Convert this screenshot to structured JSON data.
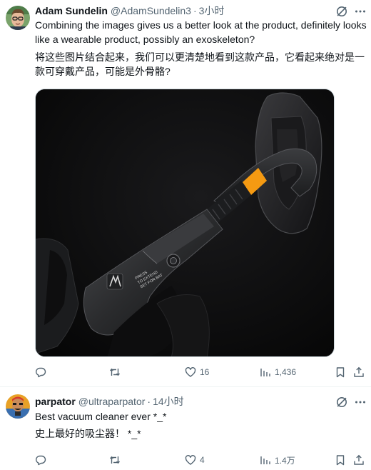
{
  "tweets": [
    {
      "author_name": "Adam Sundelin",
      "handle": "@AdamSundelin3",
      "separator": "·",
      "time": "3小时",
      "text_en": "Combining the images gives us a better look at the product, definitely looks like a wearable product, possibly an exoskeleton?",
      "text_zh": "将这些图片结合起来，我们可以更清楚地看到这款产品，它看起来绝对是一款可穿戴产品，可能是外骨骼?",
      "media_label_line1": "PRESS",
      "media_label_line2": "TO EXTEND",
      "media_label_line3": "SET FOR BAT",
      "reply_count": "",
      "retweet_count": "",
      "like_count": "16",
      "view_count": "1,436"
    },
    {
      "author_name": "parpator",
      "handle": "@ultraparpator",
      "separator": "·",
      "time": "14小时",
      "text_en": "Best vacuum cleaner ever *_*",
      "text_zh": "史上最好的吸尘器！ *_*",
      "reply_count": "",
      "retweet_count": "",
      "like_count": "4",
      "view_count": "1.4万"
    }
  ],
  "icons": {
    "grok": "grok-icon",
    "more": "more-icon",
    "reply": "reply-icon",
    "retweet": "retweet-icon",
    "like": "heart-icon",
    "views": "views-icon",
    "bookmark": "bookmark-icon",
    "share": "share-icon"
  },
  "colors": {
    "text": "#0f1419",
    "muted": "#536471",
    "divider": "#eff3f4",
    "accent_orange": "#f59a12"
  }
}
